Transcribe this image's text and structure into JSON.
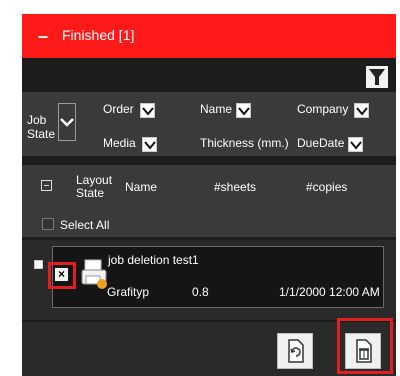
{
  "header": {
    "title": "Finished [1]",
    "collapse_symbol": "–"
  },
  "filters": {
    "job_state": "Job State",
    "job_state_line1": "Job",
    "job_state_line2": "State",
    "order": "Order",
    "name": "Name",
    "company": "Company",
    "media": "Media",
    "thickness": "Thickness (mm.)",
    "due_date": "DueDate"
  },
  "columns": {
    "layout_state_line1": "Layout",
    "layout_state_line2": "State",
    "name": "Name",
    "sheets": "#sheets",
    "copies": "#copies",
    "select_all": "Select All"
  },
  "job": {
    "name": "job deletion test1",
    "media": "Grafityp",
    "thickness": "0.8",
    "due_date": "1/1/2000 12:00 AM",
    "delete_mark": "×"
  },
  "colors": {
    "header": "#ff1a1a",
    "highlight": "#e02020",
    "panel": "#1c1c1c"
  }
}
